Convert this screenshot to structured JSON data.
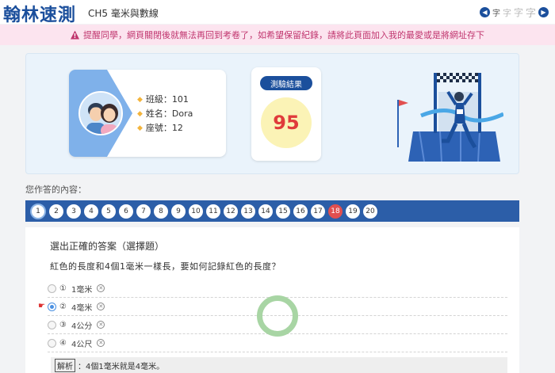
{
  "header": {
    "brand": "翰林速測",
    "chapter": "CH5 毫米與數線",
    "font_size_glyphs": [
      "字",
      "字",
      "字",
      "字"
    ]
  },
  "warning": {
    "text": "提醒同學，網頁關閉後就無法再回到考卷了，如希望保留紀錄，請將此頁面加入我的最愛或是將網址存下"
  },
  "profile": {
    "class_label": "班級：101",
    "name_label": "姓名：Dora",
    "seat_label": "座號：12"
  },
  "score": {
    "label": "測驗結果",
    "value": "95"
  },
  "answers": {
    "label": "您作答的內容：",
    "numbers": [
      "1",
      "2",
      "3",
      "4",
      "5",
      "6",
      "7",
      "8",
      "9",
      "10",
      "11",
      "12",
      "13",
      "14",
      "15",
      "16",
      "17",
      "18",
      "19",
      "20"
    ],
    "current": "1",
    "wrong": [
      "18"
    ]
  },
  "question": {
    "type": "選出正確的答案（選擇題）",
    "text": "紅色的長度和4個1毫米一樣長，要如何記錄紅色的長度？",
    "options": [
      {
        "num": "①",
        "text": "1毫米"
      },
      {
        "num": "②",
        "text": "4毫米"
      },
      {
        "num": "③",
        "text": "4公分"
      },
      {
        "num": "④",
        "text": "4公尺"
      }
    ],
    "selected": "②",
    "explain_tag": "解析",
    "explain_text": "：4個1毫米就是4毫米。"
  },
  "colors": {
    "brand": "#1b4f9c",
    "warning_text": "#c0356e",
    "warning_bg": "#fce4ef",
    "score": "#e03b3b",
    "wrong": "#e14f4f"
  }
}
